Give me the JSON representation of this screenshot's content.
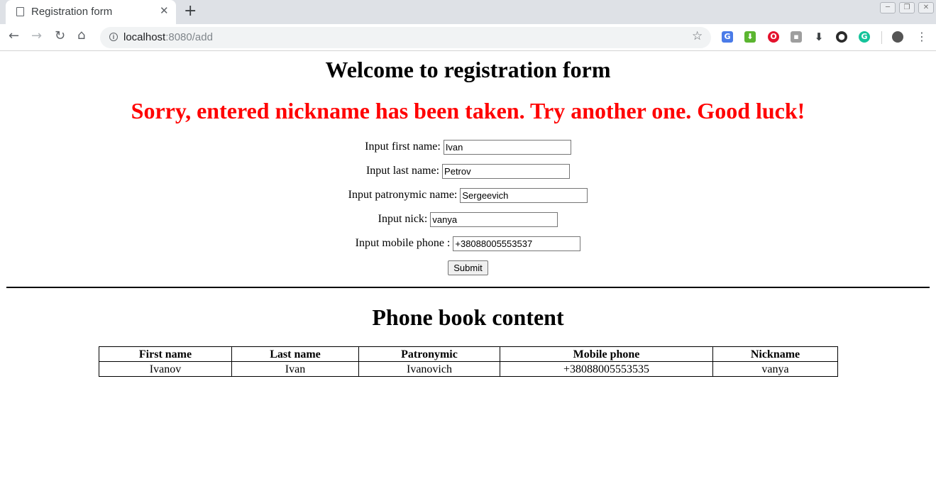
{
  "browser": {
    "tab_title": "Registration form",
    "tab_close": "✕",
    "new_tab": "+",
    "url_host": "localhost",
    "url_path": ":8080/add",
    "window_buttons": [
      "─",
      "❐",
      "✕"
    ]
  },
  "page": {
    "title": "Welcome to registration form",
    "error": "Sorry, entered nickname has been taken. Try another one. Good luck!",
    "accent_error_color": "#ff0000"
  },
  "form": {
    "first_name": {
      "label": "Input first name:",
      "value": "Ivan"
    },
    "last_name": {
      "label": "Input last name:",
      "value": "Petrov"
    },
    "patronymic": {
      "label": "Input patronymic name:",
      "value": "Sergeevich"
    },
    "nick": {
      "label": "Input nick:",
      "value": "vanya"
    },
    "phone": {
      "label": "Input mobile phone :",
      "value": "+38088005553537"
    },
    "submit_label": "Submit"
  },
  "phone_book": {
    "title": "Phone book content",
    "columns": [
      "First name",
      "Last name",
      "Patronymic",
      "Mobile phone",
      "Nickname"
    ],
    "rows": [
      [
        "Ivanov",
        "Ivan",
        "Ivanovich",
        "+38088005553535",
        "vanya"
      ]
    ]
  },
  "extensions": [
    "google-translate-icon",
    "download-arrow-icon",
    "opera-icon",
    "profile-ext-icon",
    "download-icon",
    "shield-ext-icon",
    "grammarly-icon"
  ]
}
